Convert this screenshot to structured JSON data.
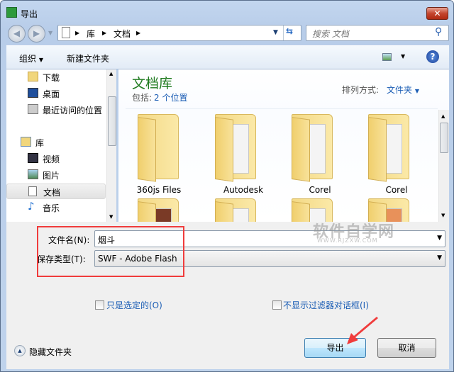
{
  "window": {
    "title": "导出",
    "close_label": "✕"
  },
  "address": {
    "segments": [
      "库",
      "文档"
    ]
  },
  "search": {
    "placeholder": "搜索 文档"
  },
  "toolbar": {
    "organize": "组织",
    "new_folder": "新建文件夹"
  },
  "nav": {
    "items": [
      {
        "label": "下载",
        "icon": "download-folder-icon"
      },
      {
        "label": "桌面",
        "icon": "desktop-icon"
      },
      {
        "label": "最近访问的位置",
        "icon": "recent-places-icon"
      },
      {
        "label": "库",
        "icon": "library-icon"
      },
      {
        "label": "视频",
        "icon": "video-icon"
      },
      {
        "label": "图片",
        "icon": "pictures-icon"
      },
      {
        "label": "文档",
        "icon": "documents-icon",
        "selected": true
      },
      {
        "label": "音乐",
        "icon": "music-icon"
      }
    ]
  },
  "library": {
    "title": "文档库",
    "includes_label": "包括:",
    "includes_link": "2 个位置",
    "arrange_label": "排列方式:",
    "arrange_value": "文件夹"
  },
  "folders": [
    {
      "name": "360js Files"
    },
    {
      "name": "Autodesk"
    },
    {
      "name": "Corel"
    },
    {
      "name": "Corel"
    }
  ],
  "form": {
    "filename_label": "文件名(N):",
    "filename_value": "烟斗",
    "filetype_label": "保存类型(T):",
    "filetype_value": "SWF - Adobe Flash"
  },
  "options": {
    "selected_only": "只是选定的(O)",
    "no_filter_dialog": "不显示过滤器对话框(I)"
  },
  "footer": {
    "hide_folders": "隐藏文件夹",
    "export": "导出",
    "cancel": "取消"
  },
  "watermark": {
    "line1": "软件自学网",
    "line2": "WWW.RJZXW.COM"
  },
  "colors": {
    "annotation": "#f03c3c",
    "accent_title": "#1e7a1e",
    "link": "#1c5eb5"
  }
}
